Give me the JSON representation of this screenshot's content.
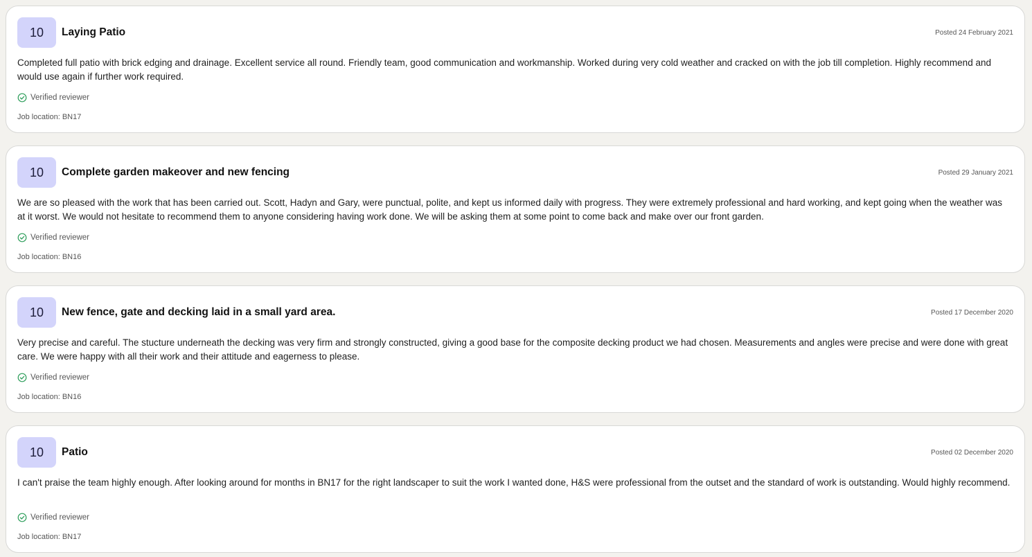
{
  "reviews": [
    {
      "score": "10",
      "title": "Laying Patio",
      "posted": "Posted 24 February 2021",
      "body": "Completed full patio with brick edging and drainage. Excellent service all round. Friendly team, good communication and workmanship. Worked during very cold weather and cracked on with the job till completion. Highly recommend and would use again if further work required.",
      "verified": "Verified reviewer",
      "location": "Job location: BN17"
    },
    {
      "score": "10",
      "title": "Complete garden makeover and new fencing",
      "posted": "Posted 29 January 2021",
      "body": "We are so pleased with the work that has been carried out. Scott, Hadyn and Gary, were punctual, polite, and kept us informed daily with progress. They were extremely professional and hard working, and kept going when the weather was at it worst. We would not hesitate to recommend them to anyone considering having work done. We will be asking them at some point to come back and make over our front garden.",
      "verified": "Verified reviewer",
      "location": "Job location: BN16"
    },
    {
      "score": "10",
      "title": "New fence, gate and decking laid in a small yard area.",
      "posted": "Posted 17 December 2020",
      "body": "Very precise and careful. The stucture underneath the decking was very firm and strongly constructed, giving a good base for the composite decking product we had chosen. Measurements and angles were precise and were done with great care. We were happy with all their work and their attitude and eagerness to please.",
      "verified": "Verified reviewer",
      "location": "Job location: BN16"
    },
    {
      "score": "10",
      "title": "Patio",
      "posted": "Posted 02 December 2020",
      "body": "I can't praise the team highly enough. After looking around for months in BN17 for the right landscaper to suit the work I wanted done, H&S were professional from the outset and the standard of work is outstanding. Would highly recommend.",
      "verified": "Verified reviewer",
      "location": "Job location: BN17"
    }
  ],
  "icons": {
    "verified": "check-circle-icon"
  },
  "colors": {
    "badge_bg": "#d3d4fb",
    "verified_green": "#2e9e5b",
    "page_bg": "#f3f2ee"
  }
}
